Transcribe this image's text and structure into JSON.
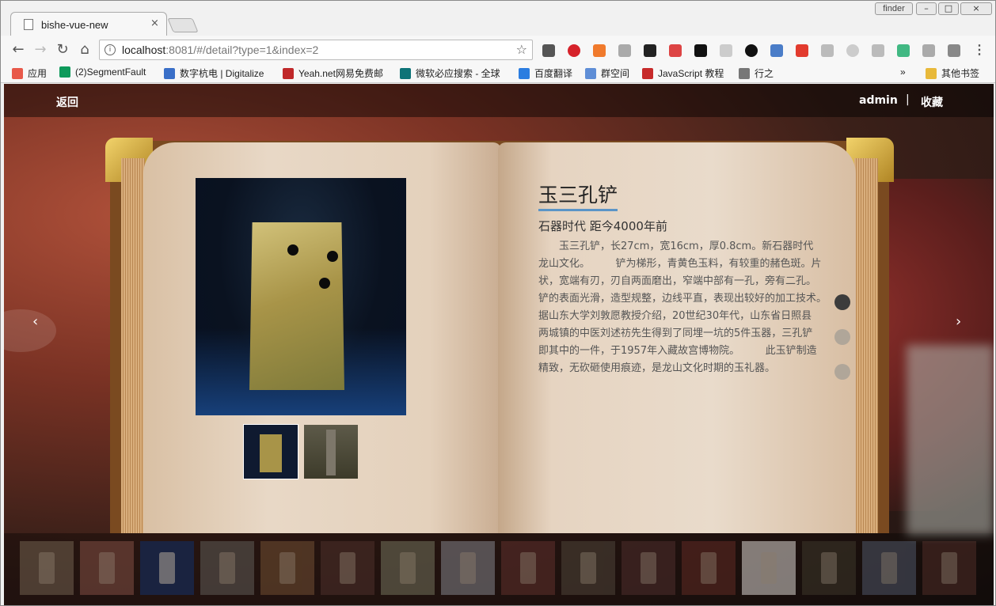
{
  "browser": {
    "tab_title": "bishe-vue-new",
    "tab_close": "×",
    "finder_label": "finder",
    "url_host": "localhost",
    "url_rest": ":8081/#/detail?type=1&index=2",
    "window_controls": [
      "–",
      "□",
      "×"
    ]
  },
  "bookmarks": [
    {
      "label": "应用",
      "color": "#e8594a",
      "icon": "apps-grid-icon"
    },
    {
      "label": "(2)SegmentFault",
      "color": "#0e9a5b",
      "icon": "sf-icon"
    },
    {
      "label": "数字杭电 | Digitalize",
      "color": "#3a6fc8",
      "icon": "hdu-icon"
    },
    {
      "label": "Yeah.net网易免费邮",
      "color": "#c0282a",
      "icon": "yeah-icon"
    },
    {
      "label": "微软必应搜索 - 全球",
      "color": "#0d7377",
      "icon": "bing-icon"
    },
    {
      "label": "百度翻译",
      "color": "#2b7de0",
      "icon": "baidu-translate-icon"
    },
    {
      "label": "群空间",
      "color": "#5f8ed6",
      "icon": "qun-icon"
    },
    {
      "label": "JavaScript 教程",
      "color": "#c72a2a",
      "icon": "js-icon"
    },
    {
      "label": "行之",
      "color": "#777777",
      "icon": "page-icon"
    },
    {
      "label": "»",
      "color": "",
      "icon": ""
    },
    {
      "label": "其他书签",
      "color": "#e8b93a",
      "icon": "folder-icon"
    }
  ],
  "header": {
    "back_label": "返回",
    "user_label": "admin",
    "separator": "|",
    "favorite_label": "收藏"
  },
  "artifact": {
    "title": "玉三孔铲",
    "era": "石器时代 距今4000年前",
    "description": "　　玉三孔铲，长27cm，宽16cm，厚0.8cm。新石器时代龙山文化。　　　铲为梯形，青黄色玉料，有较重的赭色斑。片状，宽端有刃，刃自两面磨出，窄端中部有一孔，旁有二孔。铲的表面光滑，造型规整，边线平直，表现出较好的加工技术。　　　据山东大学刘敦愿教授介绍，20世纪30年代，山东省日照县两城镇的中医刘述祊先生得到了同埋一坑的5件玉器，三孔铲即其中的一件，于1957年入藏故宫博物院。　　　此玉铲制造精致，无砍砸使用痕迹，是龙山文化时期的玉礼器。"
  },
  "pager": {
    "total": 3,
    "active": 0
  },
  "nav": {
    "prev": "‹",
    "next": "›"
  },
  "strip": {
    "count": 16,
    "active": 2,
    "colors": [
      "#6b5a4a",
      "#7a4a40",
      "#1a2340",
      "#5a5550",
      "#6b4a30",
      "#4a2e28",
      "#6b6a55",
      "#7a7a80",
      "#5a2e2a",
      "#4a4035",
      "#4a2b2a",
      "#5a2822",
      "#c9c4bf",
      "#3a3428",
      "#4a5060",
      "#4a2a25"
    ]
  }
}
